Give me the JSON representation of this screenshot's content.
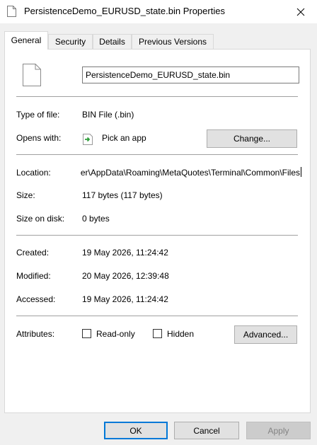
{
  "window": {
    "title": "PersistenceDemo_EURUSD_state.bin Properties",
    "close_symbol": "✕"
  },
  "tabs": [
    {
      "label": "General",
      "active": true
    },
    {
      "label": "Security",
      "active": false
    },
    {
      "label": "Details",
      "active": false
    },
    {
      "label": "Previous Versions",
      "active": false
    }
  ],
  "general": {
    "file_name": "PersistenceDemo_EURUSD_state.bin",
    "type_label": "Type of file:",
    "type_value": "BIN File (.bin)",
    "opens_with_label": "Opens with:",
    "opens_with_value": "Pick an app",
    "change_button": "Change...",
    "location_label": "Location:",
    "location_value": "C:\\Users\\User\\AppData\\Roaming\\MetaQuotes\\Terminal\\Common\\Files",
    "size_label": "Size:",
    "size_value": "117 bytes (117 bytes)",
    "size_on_disk_label": "Size on disk:",
    "size_on_disk_value": "0 bytes",
    "created_label": "Created:",
    "created_value": "19 May 2026, 11:24:42",
    "modified_label": "Modified:",
    "modified_value": "20 May 2026, 12:39:48",
    "accessed_label": "Accessed:",
    "accessed_value": "19 May 2026, 11:24:42",
    "attributes_label": "Attributes:",
    "readonly_label": "Read-only",
    "hidden_label": "Hidden",
    "advanced_button": "Advanced..."
  },
  "footer": {
    "ok": "OK",
    "cancel": "Cancel",
    "apply": "Apply"
  },
  "icons": {
    "title": "file-icon",
    "file": "file-icon",
    "app": "pick-app-icon",
    "close": "close-icon"
  },
  "colors": {
    "accent": "#0078d7",
    "app_icon_green": "#2e9e3a"
  }
}
